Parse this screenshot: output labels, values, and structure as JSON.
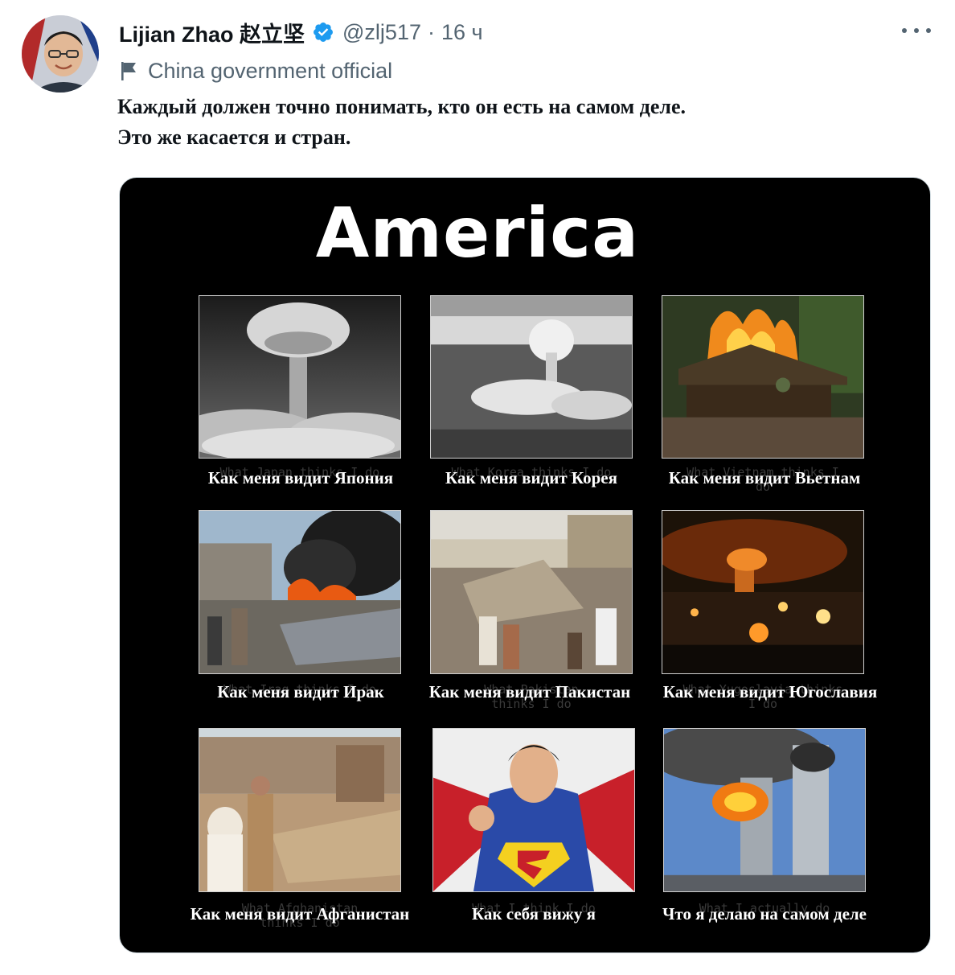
{
  "tweet": {
    "author_name": "Lijian Zhao 赵立坚",
    "handle": "@zlj517",
    "separator": "·",
    "time": "16 ч",
    "label": "China government official",
    "text_lines": [
      "Каждый должен точно понимать, кто он есть на самом деле.",
      "Это же касается и стран."
    ]
  },
  "poster": {
    "title": "America",
    "panels": [
      {
        "caption": "Как меня видит Япония",
        "ghost": "What Japan thinks I do",
        "scene": "mushroom-cloud"
      },
      {
        "caption": "Как меня видит Корея",
        "ghost": "What Korea thinks I do",
        "scene": "bombed-city"
      },
      {
        "caption": "Как меня видит Вьетнам",
        "ghost": "What Vietnam thinks I do",
        "scene": "burning-hut"
      },
      {
        "caption": "Как меня видит Ирак",
        "ghost": "What Iraq thinks I do",
        "scene": "smoke-ruins"
      },
      {
        "caption": "Как меня видит Пакистан",
        "ghost": "What Pakistan thinks I do",
        "scene": "rubble-crowd"
      },
      {
        "caption": "Как меня видит Югославия",
        "ghost": "What Yugoslavia thinks I do",
        "scene": "night-fire-city"
      },
      {
        "caption": "Как меня видит Афганистан",
        "ghost": "What Afghanistan thinks I do",
        "scene": "collapsed-houses"
      },
      {
        "caption": "Как себя вижу я",
        "ghost": "What I think I do",
        "scene": "superhero"
      },
      {
        "caption": "Что я делаю на самом деле",
        "ghost": "What I actually do",
        "scene": "burning-towers"
      }
    ]
  },
  "colors": {
    "verified": "#1d9bf0",
    "muted": "#536471",
    "text": "#0f1419",
    "poster_bg": "#000000"
  },
  "icons": {
    "verified": "verified-badge-icon",
    "more": "more-options-icon",
    "label": "flag-icon"
  }
}
